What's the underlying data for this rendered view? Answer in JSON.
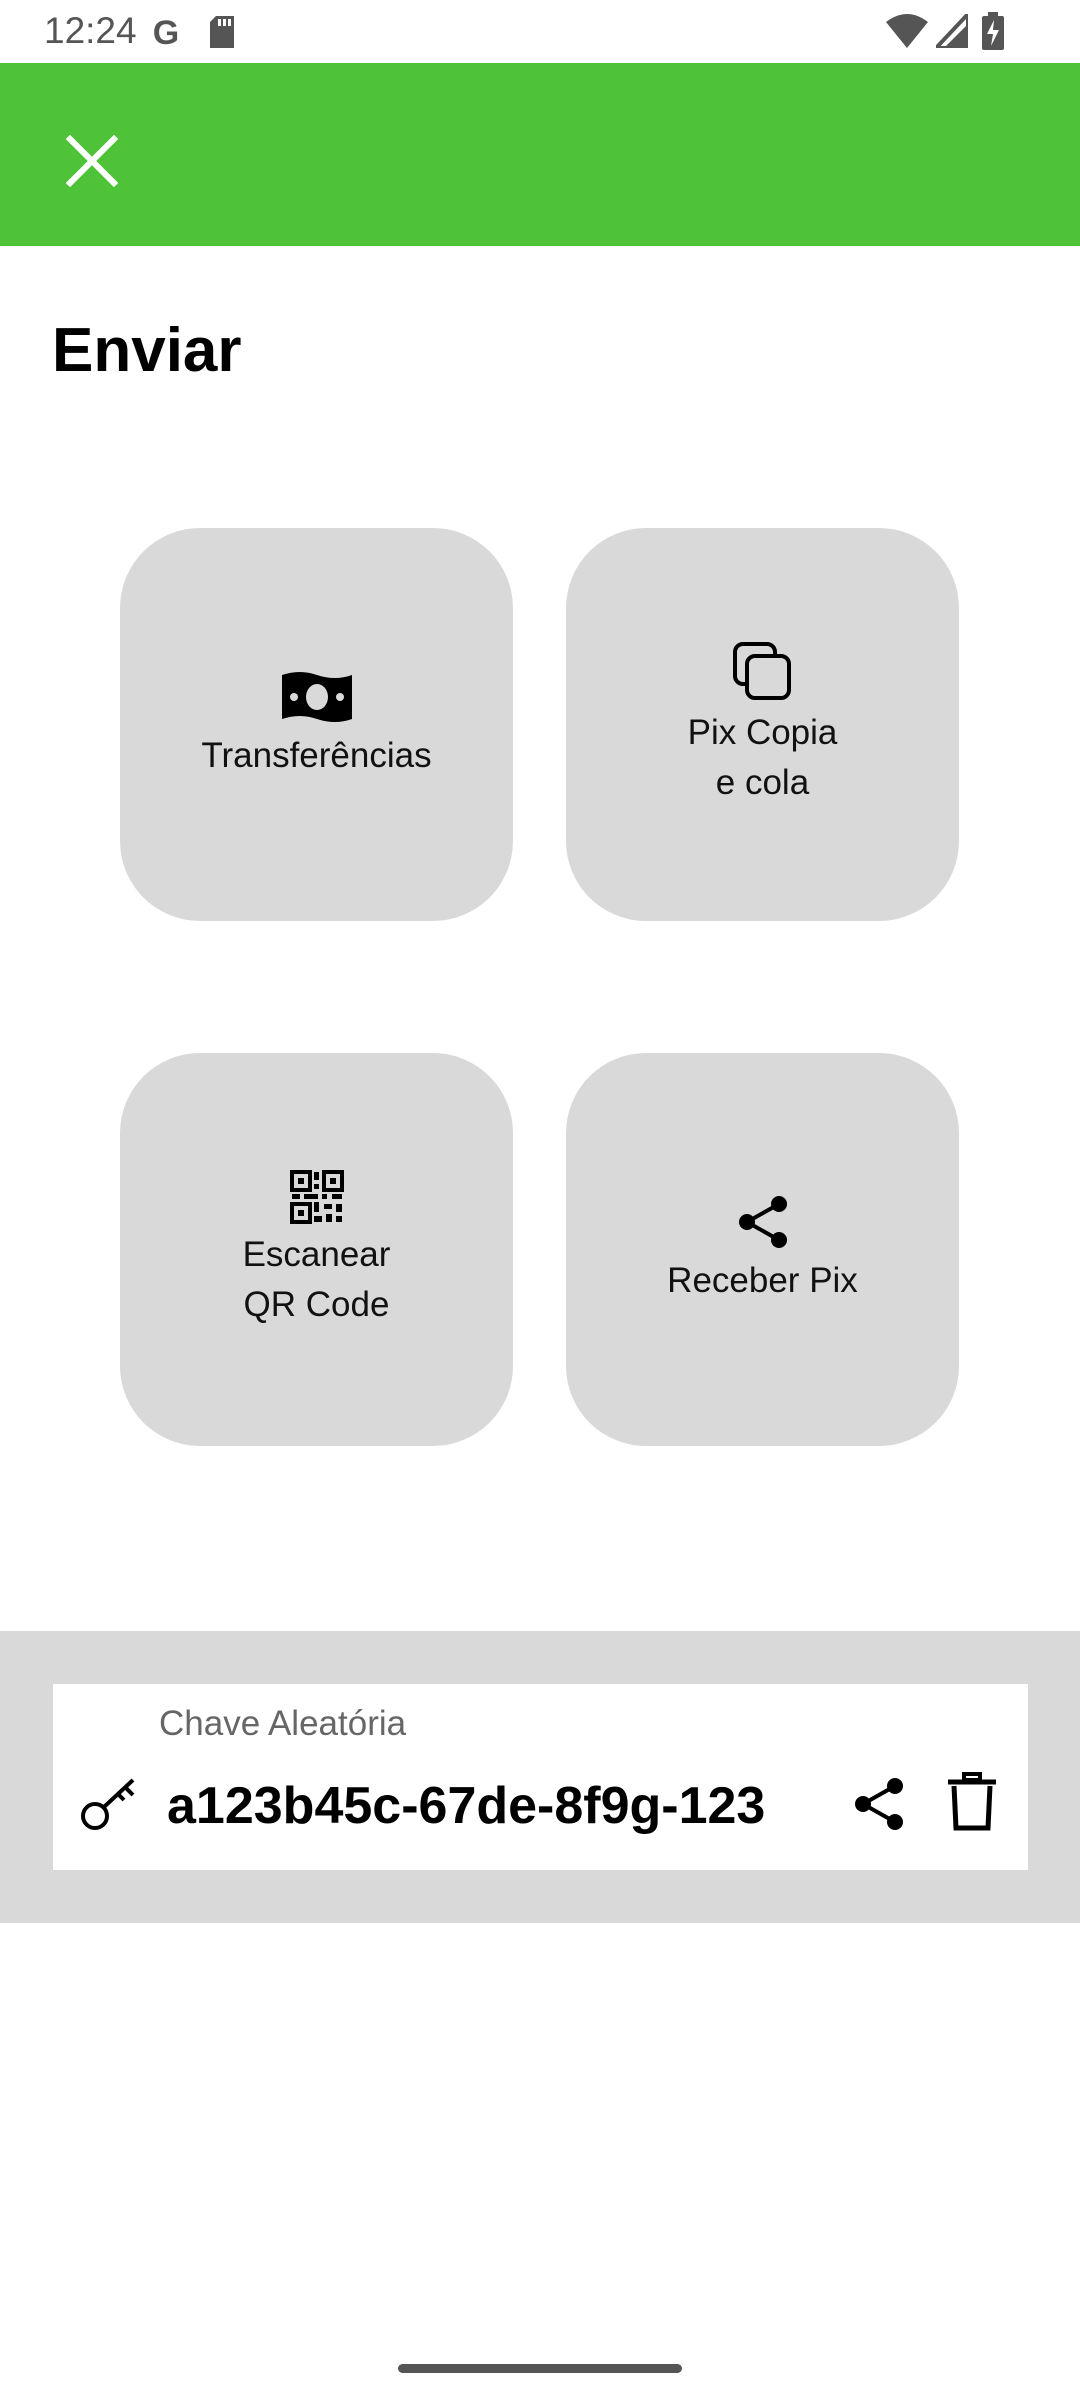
{
  "status_bar": {
    "time": "12:24",
    "icons": [
      "google-icon",
      "sd-card-icon",
      "wifi-icon",
      "signal-icon",
      "battery-charging-icon"
    ]
  },
  "app_bar": {
    "color": "#4fc338",
    "close_icon": "close-icon"
  },
  "page": {
    "title": "Enviar"
  },
  "actions": [
    {
      "label": "Transferências",
      "icon": "money-bill-icon"
    },
    {
      "label": "Pix Copia\ne cola",
      "icon": "copy-icon"
    },
    {
      "label": "Escanear\nQR Code",
      "icon": "qr-code-icon"
    },
    {
      "label": "Receber Pix",
      "icon": "share-icon"
    }
  ],
  "pix_key": {
    "type_label": "Chave Aleatória",
    "value": "a123b45c-67de-8f9g-123",
    "key_icon": "key-icon",
    "share_icon": "share-icon",
    "delete_icon": "trash-icon"
  },
  "colors": {
    "accent": "#4fc338",
    "tile_bg": "#d9d9d9",
    "panel_bg": "#d9d9d9"
  }
}
